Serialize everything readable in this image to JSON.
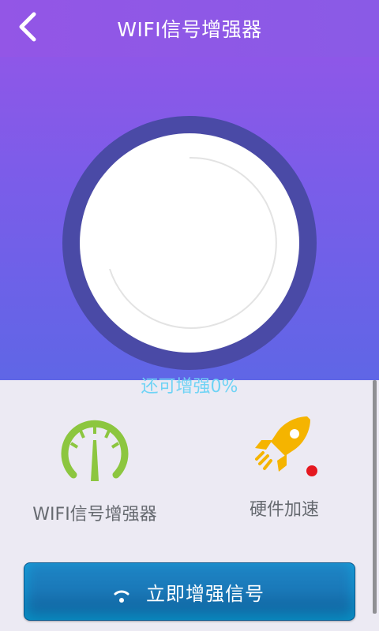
{
  "header": {
    "title": "WIFI信号增强器",
    "back_icon": "chevron-left-icon"
  },
  "hero": {
    "status_text": "还可增强0%"
  },
  "features": [
    {
      "label": "WIFI信号增强器",
      "icon": "speedometer-icon",
      "color": "#8cc63f"
    },
    {
      "label": "硬件加速",
      "icon": "rocket-icon",
      "color": "#f5b400",
      "badge_color": "#e5181f"
    }
  ],
  "cta": {
    "label": "立即增强信号",
    "icon": "wifi-icon"
  },
  "colors": {
    "header": "#9356e6",
    "ring": "#4a4aa6",
    "status_text": "#6fd3f5",
    "cta": "#1a79b9"
  }
}
